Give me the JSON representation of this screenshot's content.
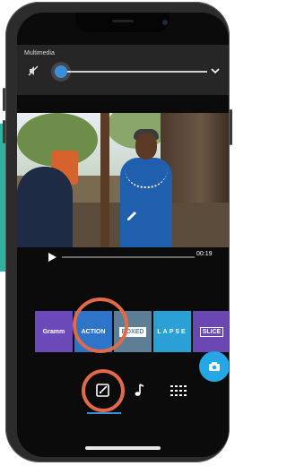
{
  "panel": {
    "title": "Multimedia",
    "volume_level": 0.0
  },
  "player": {
    "time": "00:19",
    "progress": 0.0
  },
  "styles": [
    {
      "label": "Gramm",
      "color": "#6b49b8"
    },
    {
      "label": "ACTION",
      "color": "#2e74c9"
    },
    {
      "label": "BOXED",
      "color": "#5e7e96"
    },
    {
      "label": "LAPSE",
      "color": "#2aa0d6"
    },
    {
      "label": "SLICE",
      "color": "#6a47b2"
    }
  ],
  "tabs": [
    {
      "icon": "story-edit-icon",
      "active": true
    },
    {
      "icon": "music-note-icon",
      "active": false
    },
    {
      "icon": "theme-pattern-icon",
      "active": false
    }
  ],
  "colors": {
    "accent": "#3a8fd8",
    "fab": "#24a7e4",
    "highlight_ring": "#e06a4a"
  }
}
